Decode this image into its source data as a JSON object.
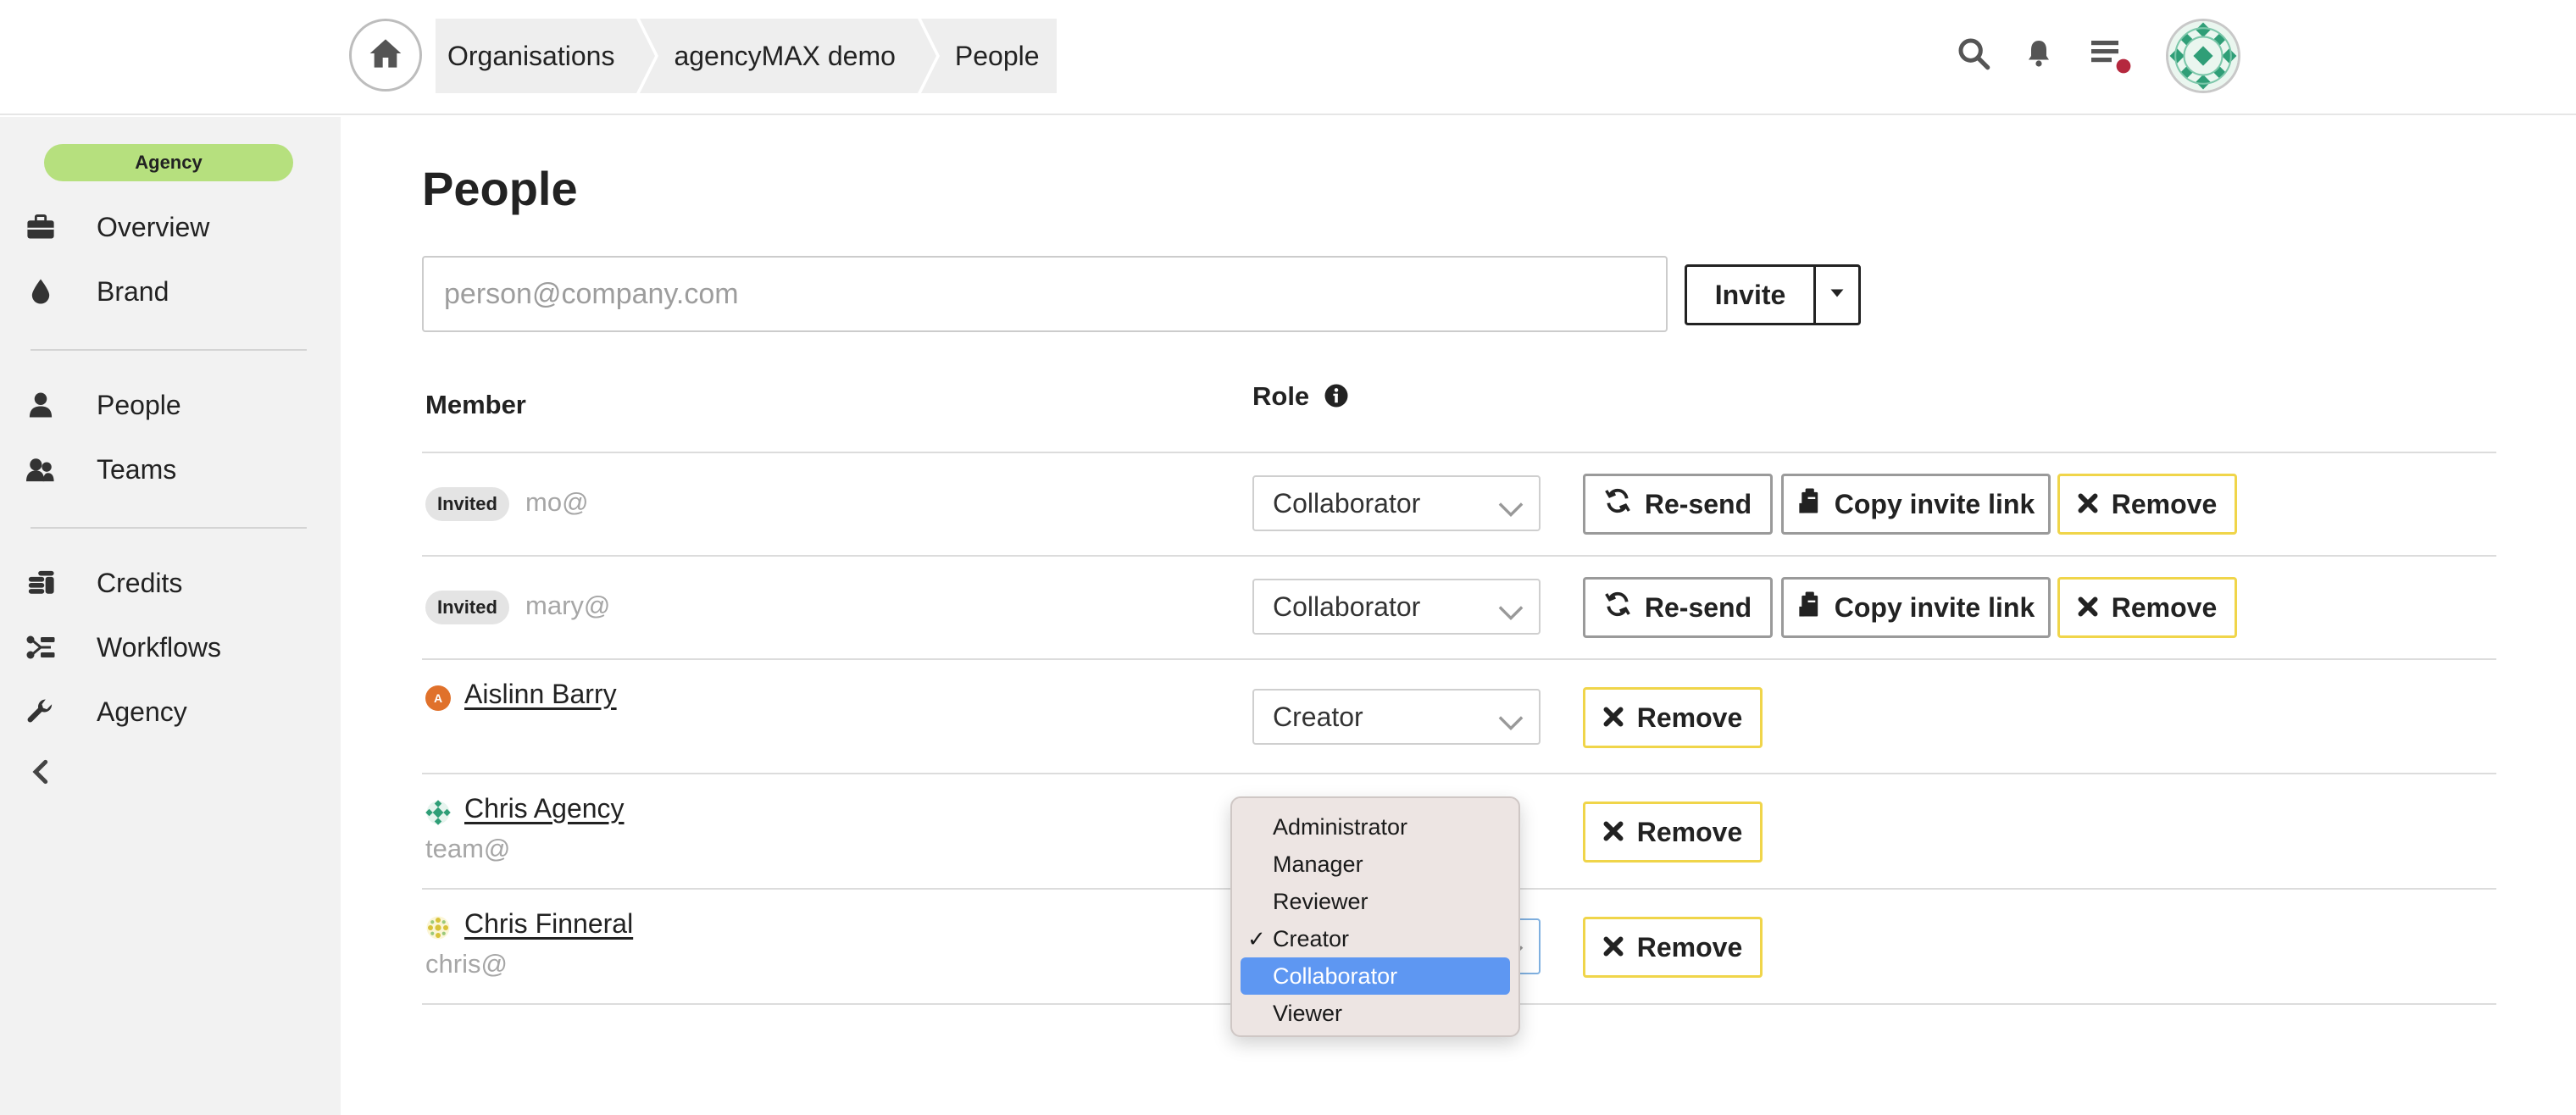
{
  "breadcrumb": {
    "items": [
      "Organisations",
      "agencyMAX demo",
      "People"
    ]
  },
  "icons": {
    "home": "home-icon",
    "search": "search-icon",
    "bell": "bell-icon",
    "tasks": "task-list-icon",
    "avatar": "user-avatar"
  },
  "colors": {
    "agency_badge": "#b6e07e",
    "remove_border": "#f0d54a",
    "menu_highlight": "#5e97f2",
    "notification_dot": "#b5283e"
  },
  "sidebar": {
    "badge": "Agency",
    "items": [
      {
        "label": "Overview",
        "icon": "briefcase-icon"
      },
      {
        "label": "Brand",
        "icon": "drop-icon"
      },
      {
        "label": "People",
        "icon": "person-icon"
      },
      {
        "label": "Teams",
        "icon": "team-icon"
      },
      {
        "label": "Credits",
        "icon": "coins-icon"
      },
      {
        "label": "Workflows",
        "icon": "workflow-icon"
      },
      {
        "label": "Agency",
        "icon": "wrench-icon"
      }
    ],
    "collapse_icon": "chevron-left-icon"
  },
  "main": {
    "title": "People",
    "invite": {
      "placeholder": "person@company.com",
      "button_label": "Invite"
    },
    "columns": {
      "member": "Member",
      "role": "Role"
    },
    "buttons": {
      "resend": "Re-send",
      "copy_link": "Copy invite link",
      "remove": "Remove"
    },
    "rows": [
      {
        "status": "Invited",
        "name": "",
        "email": "mo@",
        "role": "Collaborator"
      },
      {
        "status": "Invited",
        "name": "",
        "email": "mary@",
        "role": "Collaborator"
      },
      {
        "status": "",
        "name": "Aislinn Barry",
        "email": "",
        "role": "Creator",
        "avatar_letter": "A"
      },
      {
        "status": "",
        "name": "Chris Agency",
        "email": "team@",
        "role": "Creator"
      },
      {
        "status": "",
        "name": "Chris Finneral",
        "email": "chris@",
        "role": "Creator"
      }
    ]
  },
  "role_menu": {
    "options": [
      "Administrator",
      "Manager",
      "Reviewer",
      "Creator",
      "Collaborator",
      "Viewer"
    ],
    "checked": "Creator",
    "highlighted": "Collaborator"
  }
}
